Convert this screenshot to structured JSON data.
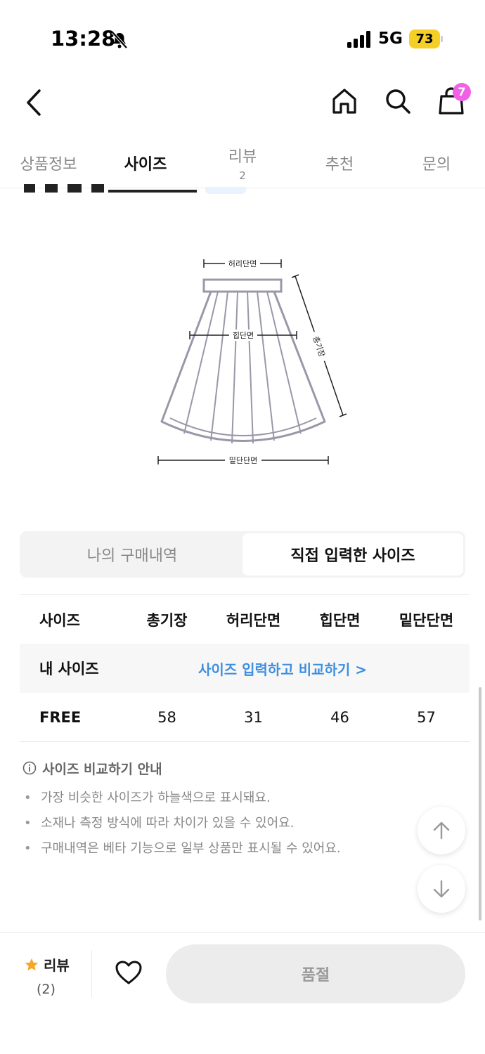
{
  "status_bar": {
    "time": "13:28",
    "network": "5G",
    "battery": "73"
  },
  "header": {
    "cart_count": "7"
  },
  "tabs": [
    {
      "label": "상품정보"
    },
    {
      "label": "사이즈"
    },
    {
      "label": "리뷰",
      "count": "2"
    },
    {
      "label": "추천"
    },
    {
      "label": "문의"
    }
  ],
  "diagram": {
    "waist": "허리단면",
    "hip": "힙단면",
    "hem": "밑단단면",
    "length": "총기장"
  },
  "segment": {
    "left": "나의 구매내역",
    "right": "직접 입력한 사이즈"
  },
  "size_table": {
    "headers": [
      "사이즈",
      "총기장",
      "허리단면",
      "힙단면",
      "밑단단면"
    ],
    "my_size_label": "내 사이즈",
    "compare_link": "사이즈 입력하고 비교하기 >",
    "rows": [
      {
        "size": "FREE",
        "values": [
          "58",
          "31",
          "46",
          "57"
        ]
      }
    ]
  },
  "notice": {
    "title": "사이즈 비교하기 안내",
    "items": [
      "가장 비슷한 사이즈가 하늘색으로 표시돼요.",
      "소재나 측정 방식에 따라 차이가 있을 수 있어요.",
      "구매내역은 베타 기능으로 일부 상품만 표시될 수 있어요."
    ]
  },
  "bottom": {
    "review_label": "리뷰",
    "review_count": "(2)",
    "soldout_label": "품절"
  },
  "colors": {
    "accent_link": "#3d8fe0",
    "star": "#f5a623",
    "badge": "#f061e6",
    "battery": "#f5cf26"
  }
}
